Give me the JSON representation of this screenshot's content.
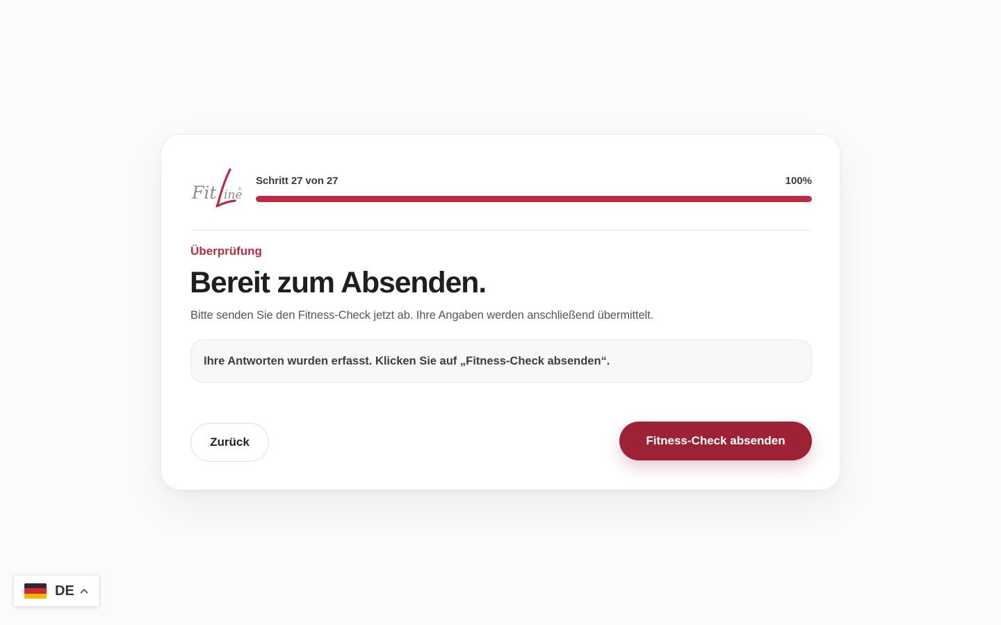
{
  "brand": {
    "logo_text_fit": "Fit",
    "logo_text_line": "Line",
    "logo_mark": "®",
    "accent_color": "#bd2a44",
    "button_color": "#9d2236"
  },
  "progress": {
    "step_label": "Schritt 27 von 27",
    "percent_label": "100%",
    "value": 1.0
  },
  "content": {
    "eyebrow": "Überprüfung",
    "title": "Bereit zum Absenden.",
    "subtitle": "Bitte senden Sie den Fitness-Check jetzt ab. Ihre Angaben werden anschließend übermittelt.",
    "info_message": "Ihre Antworten wurden erfasst. Klicken Sie auf „Fitness-Check absenden“."
  },
  "actions": {
    "back_label": "Zurück",
    "submit_label": "Fitness-Check absenden"
  },
  "language": {
    "code": "DE",
    "flag_icon": "germany-flag-icon",
    "chevron_icon": "chevron-up-icon"
  }
}
